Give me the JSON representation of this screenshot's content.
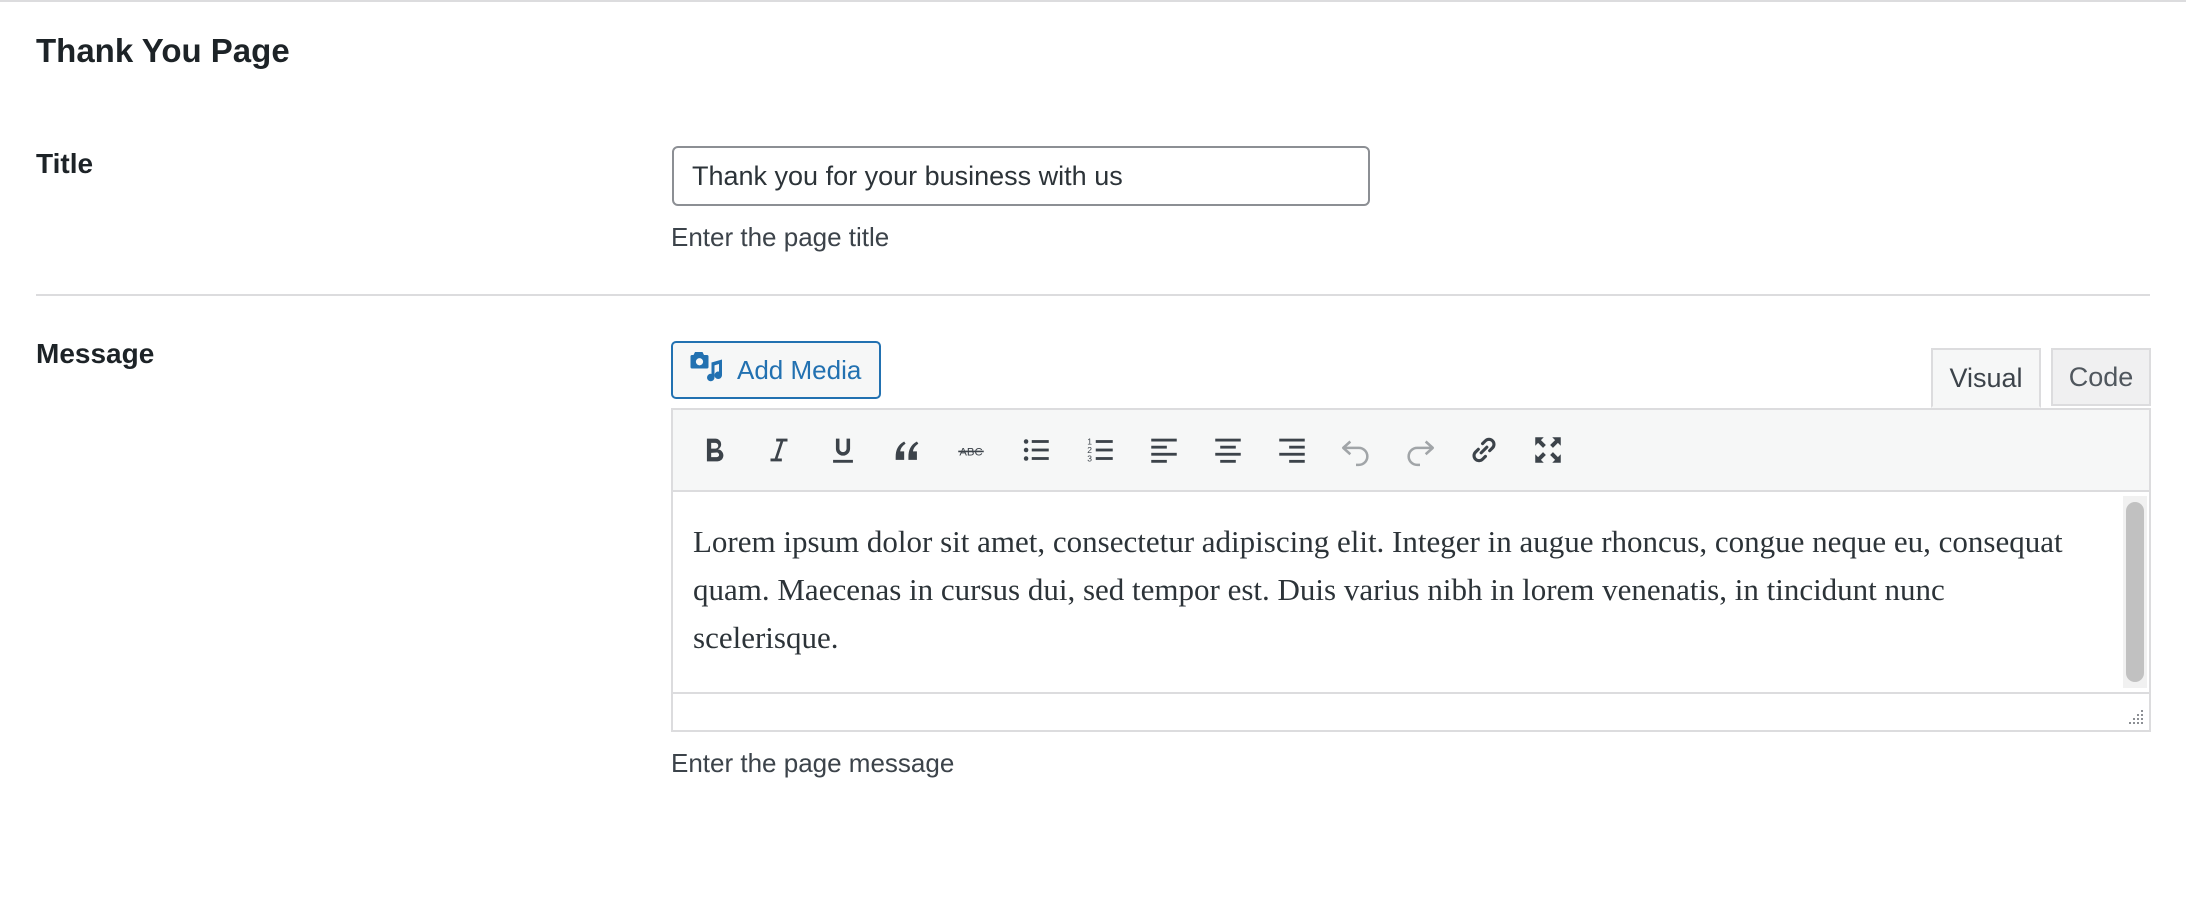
{
  "page": {
    "heading": "Thank You Page"
  },
  "title_field": {
    "label": "Title",
    "value": "Thank you for your business with us",
    "description": "Enter the page title"
  },
  "message_field": {
    "label": "Message",
    "add_media_label": "Add Media",
    "tabs": {
      "visual": "Visual",
      "code": "Code",
      "active": "Visual"
    },
    "toolbar": [
      {
        "name": "bold-icon",
        "disabled": false
      },
      {
        "name": "italic-icon",
        "disabled": false
      },
      {
        "name": "underline-icon",
        "disabled": false
      },
      {
        "name": "blockquote-icon",
        "disabled": false
      },
      {
        "name": "strikethrough-icon",
        "disabled": false
      },
      {
        "name": "bulleted-list-icon",
        "disabled": false
      },
      {
        "name": "numbered-list-icon",
        "disabled": false
      },
      {
        "name": "align-left-icon",
        "disabled": false
      },
      {
        "name": "align-center-icon",
        "disabled": false
      },
      {
        "name": "align-right-icon",
        "disabled": false
      },
      {
        "name": "undo-icon",
        "disabled": true
      },
      {
        "name": "redo-icon",
        "disabled": true
      },
      {
        "name": "link-icon",
        "disabled": false
      },
      {
        "name": "fullscreen-icon",
        "disabled": false
      }
    ],
    "content": "Lorem ipsum dolor sit amet, consectetur adipiscing elit. Integer in augue rhoncus, congue neque eu, consequat quam. Maecenas in cursus dui, sed tempor est. Duis varius nibh in lorem venenatis, in tincidunt nunc scelerisque.",
    "description": "Enter the page message"
  },
  "colors": {
    "accent": "#2271b1",
    "text": "#1d2327",
    "border": "#dcdcde"
  }
}
